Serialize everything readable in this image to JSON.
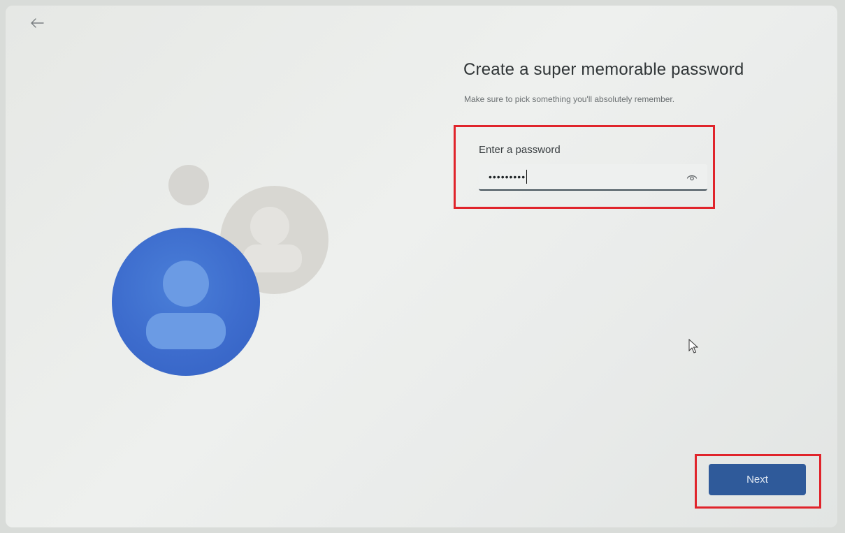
{
  "header": {
    "back_icon": "arrow-left-icon"
  },
  "page": {
    "title": "Create a super memorable password",
    "subtitle": "Make sure to pick something you'll absolutely remember."
  },
  "password_field": {
    "label": "Enter a password",
    "value": "•••••••••",
    "reveal_icon": "eye-icon"
  },
  "footer": {
    "next_label": "Next"
  },
  "colors": {
    "accent": "#2f5a9a",
    "highlight": "#e0242b",
    "avatar_blue": "#3d6ccd"
  }
}
